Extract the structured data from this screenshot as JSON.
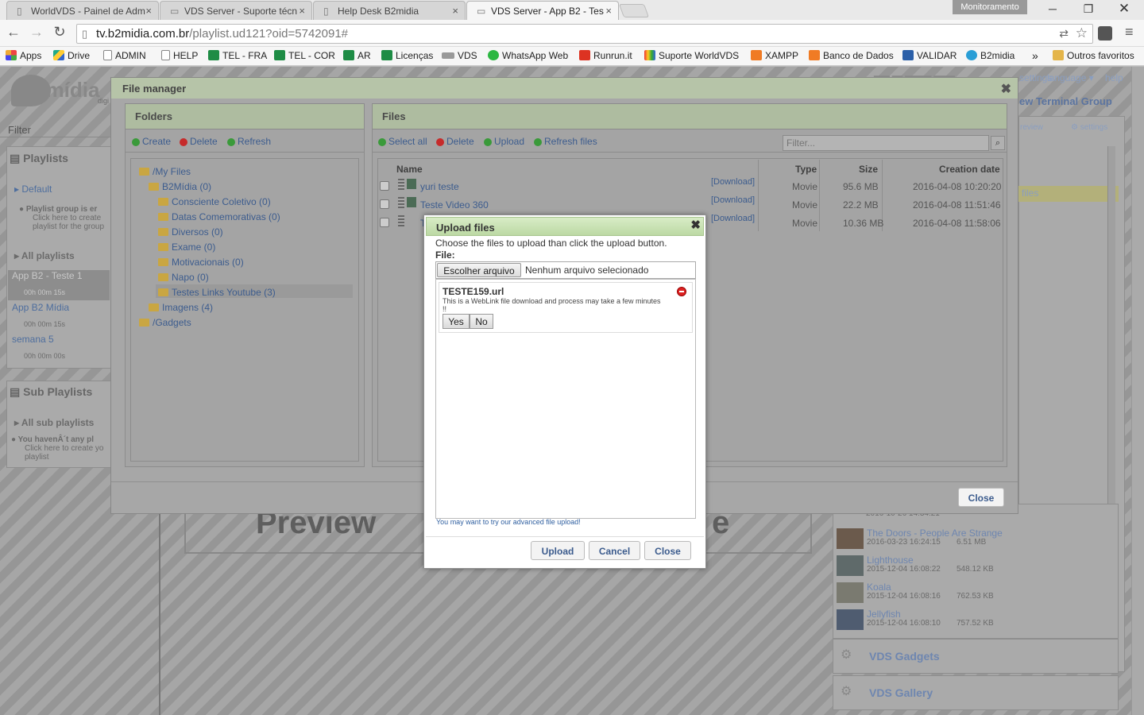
{
  "browser": {
    "tabs": [
      {
        "title": "WorldVDS - Painel de Adm"
      },
      {
        "title": "VDS Server - Suporte técn"
      },
      {
        "title": "Help Desk B2midia"
      },
      {
        "title": "VDS Server - App B2 - Tes"
      }
    ],
    "profile_label": "Monitoramento",
    "url_host": "tv.b2midia.com.br",
    "url_path": "/playlist.ud121?oid=5742091#",
    "bookmarks": [
      "Apps",
      "Drive",
      "ADMIN",
      "HELP",
      "TEL - FRA",
      "TEL - COR",
      "AR",
      "Licenças",
      "VDS",
      "WhatsApp Web",
      "Runrun.it",
      "Suporte WorldVDS",
      "XAMPP",
      "Banco de Dados",
      "VALIDAR",
      "B2midia"
    ],
    "bookmarks_more": "»",
    "other_bookmarks": "Outros favoritos"
  },
  "background": {
    "logo": "b2 mídia",
    "logo_sub": "digi",
    "filter": "Filter",
    "playlists_header": "Playlists",
    "default": "Default",
    "playlist_group_msg": "Playlist group is er",
    "click_here_1": "Click here to create",
    "playlist_for_group": "playlist for the group",
    "all_playlists": "All playlists",
    "items": [
      {
        "name": "App B2 - Teste 1",
        "time": "00h 00m 15s"
      },
      {
        "name": "App B2 Mídia",
        "time": "00h 00m 15s"
      },
      {
        "name": "semana 5",
        "time": "00h 00m 00s"
      }
    ],
    "sub_playlists": "Sub Playlists",
    "all_sub_playlists": "All sub playlists",
    "no_sub_msg": "You havenÂ´t any pl",
    "click_here_2": "Click here to create yo",
    "playlist_word": "playlist",
    "settings": "settings",
    "language": "language ▾",
    "help": "help",
    "new_terminal_group": "ew Terminal Group",
    "preview_small": "review",
    "preview_big": "Preview",
    "preview_tail": "e",
    "files_label": "files",
    "media": [
      {
        "name": "The Doors - People Are Strange",
        "date": "2016-03-23 16:24:15",
        "size": "6.51 MB"
      },
      {
        "name": "Lighthouse",
        "date": "2015-12-04 16:08:22",
        "size": "548.12 KB"
      },
      {
        "name": "Koala",
        "date": "2015-12-04 16:08:16",
        "size": "762.53 KB"
      },
      {
        "name": "Jellyfish",
        "date": "2015-12-04 16:08:10",
        "size": "757.52 KB"
      }
    ],
    "media_partial_date": "2016-10-26 14:34:21",
    "vds_gadgets": "VDS Gadgets",
    "vds_gallery": "VDS Gallery"
  },
  "file_manager": {
    "title": "File manager",
    "folders_header": "Folders",
    "folder_actions": [
      "Create",
      "Delete",
      "Refresh"
    ],
    "tree": [
      {
        "label": "/My Files"
      },
      {
        "label": "B2Mídia (0)"
      },
      {
        "label": "Consciente Coletivo (0)"
      },
      {
        "label": "Datas Comemorativas (0)"
      },
      {
        "label": "Diversos (0)"
      },
      {
        "label": "Exame (0)"
      },
      {
        "label": "Motivacionais (0)"
      },
      {
        "label": "Napo (0)"
      },
      {
        "label": "Testes Links Youtube (3)"
      },
      {
        "label": "Imagens (4)"
      },
      {
        "label": "/Gadgets"
      }
    ],
    "files_header": "Files",
    "file_actions": [
      "Select all",
      "Delete",
      "Upload",
      "Refresh files"
    ],
    "filter_placeholder": "Filter...",
    "columns": [
      "Name",
      "Type",
      "Size",
      "Creation date"
    ],
    "rows": [
      {
        "name": "yuri teste",
        "download": "[Download]",
        "type": "Movie",
        "size": "95.6 MB",
        "date": "2016-04-08 10:20:20"
      },
      {
        "name": "Teste Video 360",
        "download": "[Download]",
        "type": "Movie",
        "size": "22.2 MB",
        "date": "2016-04-08 11:51:46"
      },
      {
        "name": "T",
        "download": "[Download]",
        "type": "Movie",
        "size": "10.36 MB",
        "date": "2016-04-08 11:58:06"
      }
    ],
    "close": "Close"
  },
  "upload": {
    "title": "Upload files",
    "instructions": "Choose the files to upload than click the upload button.",
    "file_label": "File:",
    "choose_btn": "Escolher arquivo",
    "no_file": "Nenhum arquivo selecionado",
    "queued_name": "TESTE159.url",
    "queued_msg": "This is a WebLink file download and process may take a few minutes !!",
    "yes": "Yes",
    "no": "No",
    "advanced_link": "You may want to try our advanced file upload!",
    "buttons": [
      "Upload",
      "Cancel",
      "Close"
    ]
  }
}
